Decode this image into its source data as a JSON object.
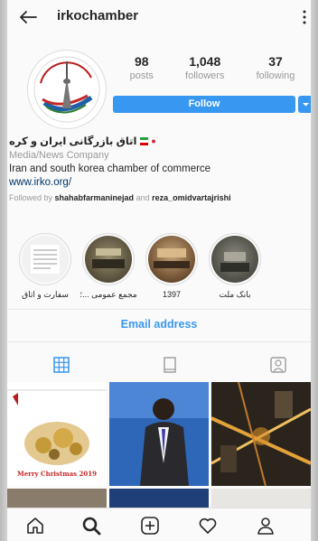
{
  "header": {
    "username": "irkochamber"
  },
  "stats": [
    {
      "num": "98",
      "label": "posts"
    },
    {
      "num": "1,048",
      "label": "followers"
    },
    {
      "num": "37",
      "label": "following"
    }
  ],
  "follow_label": "Follow",
  "bio": {
    "name": "اتاق بازرگانی ایران و کره",
    "category": "Media/News Company",
    "description": "Iran and south korea chamber of commerce",
    "link": "www.irko.org/",
    "followed_prefix": "Followed by ",
    "followed_user1": "shahabfarmaninejad",
    "followed_and": " and ",
    "followed_user2": "reza_omidvartajrishi"
  },
  "highlights": [
    {
      "label": "سفارت و اتاق"
    },
    {
      "label": "مجمع عمومی ...؛"
    },
    {
      "label": "1397"
    },
    {
      "label": "بانک ملت"
    }
  ],
  "email_label": "Email address",
  "posts": [
    {
      "caption": "Merry Christmas 2019"
    }
  ],
  "colors": {
    "accent": "#3897f0",
    "text": "#262626",
    "muted": "#999999"
  }
}
